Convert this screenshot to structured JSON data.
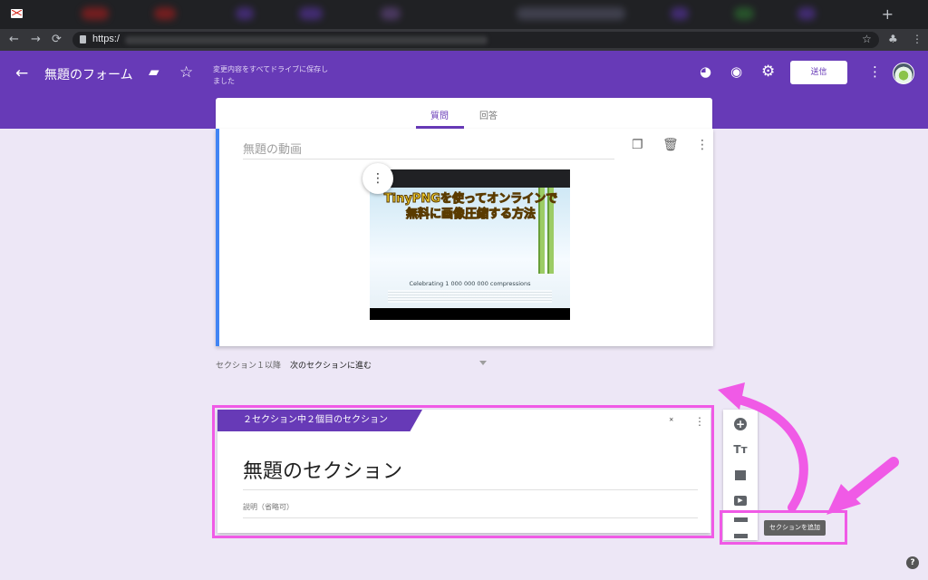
{
  "browser": {
    "url": "https:/",
    "new_tab_icon": "plus-icon",
    "tab_favicon": "gmail-icon"
  },
  "header": {
    "form_title": "無題のフォーム",
    "saved_status": "変更内容をすべてドライブに保存しました",
    "send_label": "送信",
    "icons": [
      "back-arrow-icon",
      "folder-icon",
      "star-icon",
      "palette-icon",
      "preview-eye-icon",
      "settings-gear-icon",
      "more-vert-icon",
      "avatar"
    ]
  },
  "tabs": [
    {
      "label": "質問",
      "selected": true
    },
    {
      "label": "回答",
      "selected": false
    }
  ],
  "question_card": {
    "title_placeholder": "無題の動画",
    "video_thumbnail": {
      "headline": "TinyPNGを使ってオンラインで無料に画像圧縮する方法",
      "subtext": "Celebrating 1 000 000 000 compressions"
    }
  },
  "after_section": {
    "label": "セクション１以降",
    "value": "次のセクションに進む"
  },
  "section_card": {
    "flag_label": "２セクション中２個目のセクション",
    "title": "無題のセクション",
    "description_placeholder": "説明（省略可）"
  },
  "toolbar": {
    "tooltip": "セクションを追加",
    "title_text_icon": "Tт"
  },
  "colors": {
    "accent": "#673ab7",
    "highlight": "#f05ae6",
    "background": "#ede7f6"
  }
}
